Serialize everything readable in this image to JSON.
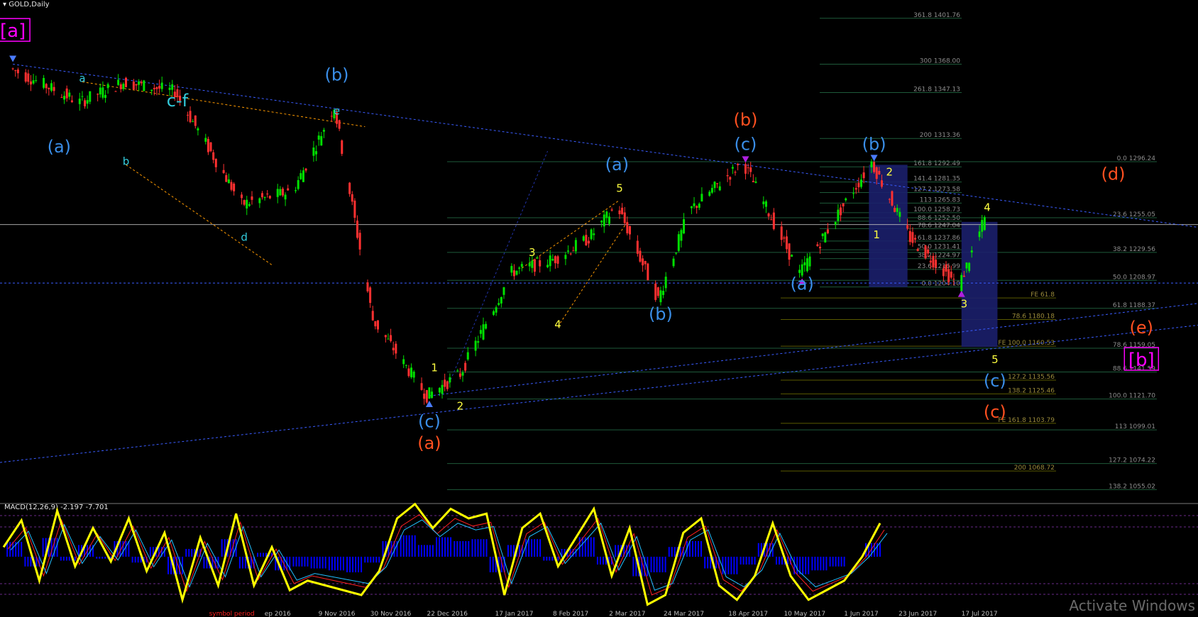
{
  "chart_data": [
    {
      "type": "candlestick",
      "title": "GOLD,Daily",
      "colors": {
        "up": "#00e000",
        "down": "#ff3030",
        "background": "#000000",
        "fib": "#1e5a3a",
        "fib_ext": "#5a5a00",
        "trend": "#3a5cff",
        "box": "#1b1f6b"
      },
      "price_points": [
        {
          "date": "2016-07-06",
          "price": 1365
        },
        {
          "date": "2016-08-02",
          "price": 1340
        },
        {
          "date": "2016-08-19",
          "price": 1355
        },
        {
          "date": "2016-09-08",
          "price": 1348
        },
        {
          "date": "2016-10-04",
          "price": 1265
        },
        {
          "date": "2016-10-24",
          "price": 1275
        },
        {
          "date": "2016-11-01",
          "price": 1305
        },
        {
          "date": "2016-11-09",
          "price": 1337
        },
        {
          "date": "2016-11-24",
          "price": 1180
        },
        {
          "date": "2016-12-15",
          "price": 1124
        },
        {
          "date": "2016-12-28",
          "price": 1140
        },
        {
          "date": "2017-01-17",
          "price": 1215
        },
        {
          "date": "2017-02-03",
          "price": 1225
        },
        {
          "date": "2017-02-16",
          "price": 1240
        },
        {
          "date": "2017-02-27",
          "price": 1264
        },
        {
          "date": "2017-03-15",
          "price": 1195
        },
        {
          "date": "2017-03-27",
          "price": 1260
        },
        {
          "date": "2017-04-17",
          "price": 1296
        },
        {
          "date": "2017-05-09",
          "price": 1214
        },
        {
          "date": "2017-06-06",
          "price": 1296
        },
        {
          "date": "2017-06-21",
          "price": 1240
        },
        {
          "date": "2017-07-10",
          "price": 1205
        },
        {
          "date": "2017-07-20",
          "price": 1254
        }
      ],
      "x_tick_labels": [
        "ep 2016",
        "9 Nov 2016",
        "30 Nov 2016",
        "22 Dec 2016",
        "17 Jan 2017",
        "8 Feb 2017",
        "2 Mar 2017",
        "24 Mar 2017",
        "18 Apr 2017",
        "10 May 2017",
        "1 Jun 2017",
        "23 Jun 2017",
        "17 Jul 2017"
      ],
      "bottom_note": "symbol period",
      "fib_levels_right": [
        {
          "label": "361.8 1401.76",
          "price": 1401.76
        },
        {
          "label": "300 1368.00",
          "price": 1368.0
        },
        {
          "label": "261.8 1347.13",
          "price": 1347.13
        },
        {
          "label": "200 1313.36",
          "price": 1313.36
        },
        {
          "label": "161.8 1292.49",
          "price": 1292.49
        },
        {
          "label": "141.4 1281.35",
          "price": 1281.35
        },
        {
          "label": "127.2 1273.58",
          "price": 1273.58
        },
        {
          "label": "113 1265.83",
          "price": 1265.83
        },
        {
          "label": "100.0 1258.73",
          "price": 1258.73
        },
        {
          "label": "88.6 1252.50",
          "price": 1252.5
        },
        {
          "label": "78.6 1247.04",
          "price": 1247.04
        },
        {
          "label": "61.8 1237.86",
          "price": 1237.86
        },
        {
          "label": "50.0 1231.41",
          "price": 1231.41
        },
        {
          "label": "38.2 1224.97",
          "price": 1224.97
        },
        {
          "label": "23.6 1216.99",
          "price": 1216.99
        },
        {
          "label": "0.0 1204.10",
          "price": 1204.1
        }
      ],
      "fib_levels_far": [
        {
          "label": "0.0 1296.24",
          "price": 1296.24
        },
        {
          "label": "23.6 1255.05",
          "price": 1255.05
        },
        {
          "label": "38.2 1229.56",
          "price": 1229.56
        },
        {
          "label": "50.0 1208.97",
          "price": 1208.97
        },
        {
          "label": "61.8 1188.37",
          "price": 1188.37
        },
        {
          "label": "78.6 1159.05",
          "price": 1159.05
        },
        {
          "label": "88.6 1141.59",
          "price": 1141.59
        },
        {
          "label": "100.0 1121.70",
          "price": 1121.7
        },
        {
          "label": "113 1099.01",
          "price": 1099.01
        },
        {
          "label": "127.2 1074.22",
          "price": 1074.22
        },
        {
          "label": "138.2 1055.02",
          "price": 1055.02
        }
      ],
      "fib_ext_levels": [
        {
          "label": "FE 61.8",
          "price": 1196
        },
        {
          "label": "78.6 1180.18",
          "price": 1180.18
        },
        {
          "label": "FE 100.0 1160.53",
          "price": 1160.53
        },
        {
          "label": "127.2 1135.56",
          "price": 1135.56
        },
        {
          "label": "138.2 1125.46",
          "price": 1125.46
        },
        {
          "label": "FE 161.8 1103.79",
          "price": 1103.79
        },
        {
          "label": "200 1068.72",
          "price": 1068.72
        }
      ],
      "wave_labels": [
        {
          "text": "[a]",
          "color": "#ff00ff",
          "date": "2016-07-06",
          "price": 1388
        },
        {
          "text": "a",
          "color": "#33ccdd",
          "date": "2016-08-02",
          "price": 1355
        },
        {
          "text": "(a)",
          "color": "#3a8ee8",
          "date": "2016-07-24",
          "price": 1303
        },
        {
          "text": "b",
          "color": "#33ccdd",
          "date": "2016-08-19",
          "price": 1294
        },
        {
          "text": "c-f",
          "color": "#33ccdd",
          "date": "2016-09-08",
          "price": 1337
        },
        {
          "text": "d",
          "color": "#33ccdd",
          "date": "2016-10-04",
          "price": 1238
        },
        {
          "text": "(b)",
          "color": "#3a8ee8",
          "date": "2016-11-09",
          "price": 1356
        },
        {
          "text": "e",
          "color": "#33ccdd",
          "date": "2016-11-09",
          "price": 1331
        },
        {
          "text": "(c)",
          "color": "#3a8ee8",
          "date": "2016-12-15",
          "price": 1101
        },
        {
          "text": "(a)",
          "color": "#ff5020",
          "date": "2016-12-15",
          "price": 1085
        },
        {
          "text": "1",
          "color": "#ffff40",
          "date": "2016-12-17",
          "price": 1142
        },
        {
          "text": "2",
          "color": "#ffff40",
          "date": "2016-12-27",
          "price": 1114
        },
        {
          "text": "3",
          "color": "#ffff40",
          "date": "2017-01-24",
          "price": 1227
        },
        {
          "text": "4",
          "color": "#ffff40",
          "date": "2017-02-03",
          "price": 1174
        },
        {
          "text": "5",
          "color": "#ffff40",
          "date": "2017-02-27",
          "price": 1274
        },
        {
          "text": "(a)",
          "color": "#3a8ee8",
          "date": "2017-02-26",
          "price": 1290
        },
        {
          "text": "(b)",
          "color": "#3a8ee8",
          "date": "2017-03-15",
          "price": 1180
        },
        {
          "text": "(b)",
          "color": "#ff5020",
          "date": "2017-04-17",
          "price": 1323
        },
        {
          "text": "(c)",
          "color": "#3a8ee8",
          "date": "2017-04-17",
          "price": 1305
        },
        {
          "text": "(a)",
          "color": "#3a8ee8",
          "date": "2017-05-09",
          "price": 1202
        },
        {
          "text": "(b)",
          "color": "#3a8ee8",
          "date": "2017-06-06",
          "price": 1305
        },
        {
          "text": "2",
          "color": "#ffff40",
          "date": "2017-06-12",
          "price": 1286
        },
        {
          "text": "1",
          "color": "#ffff40",
          "date": "2017-06-07",
          "price": 1240
        },
        {
          "text": "4",
          "color": "#ffff40",
          "date": "2017-07-20",
          "price": 1260
        },
        {
          "text": "3",
          "color": "#ffff40",
          "date": "2017-07-11",
          "price": 1189
        },
        {
          "text": "5",
          "color": "#ffff40",
          "date": "2017-07-23",
          "price": 1148
        },
        {
          "text": "(c)",
          "color": "#3a8ee8",
          "date": "2017-07-23",
          "price": 1131
        },
        {
          "text": "(c)",
          "color": "#ff5020",
          "date": "2017-07-23",
          "price": 1108
        },
        {
          "text": "(d)",
          "color": "#ff5020",
          "date": "2017-09-07",
          "price": 1283
        },
        {
          "text": "(e)",
          "color": "#ff5020",
          "date": "2017-09-18",
          "price": 1170
        },
        {
          "text": "[b]",
          "color": "#ff00ff",
          "date": "2017-09-18",
          "price": 1146
        }
      ]
    },
    {
      "type": "line",
      "title": "MACD(12,26,9) -2.197 -7.701",
      "series": [
        {
          "name": "MACD",
          "color": "#ffff00",
          "values": [
            10,
            38,
            -25,
            48,
            -10,
            30,
            -5,
            40,
            -15,
            25,
            -45,
            20,
            -30,
            45,
            -30,
            10,
            -35,
            -25,
            -30,
            -35,
            -40,
            -15,
            40,
            55,
            30,
            50,
            40,
            45,
            -40,
            30,
            45,
            -10,
            20,
            50,
            -20,
            30,
            -50,
            -40,
            25,
            40,
            -30,
            -45,
            -20,
            35,
            -20,
            -45,
            -35,
            -25,
            0,
            35
          ]
        }
      ],
      "histogram_color": "#0000ff"
    }
  ],
  "watermark": "Activate Windows"
}
